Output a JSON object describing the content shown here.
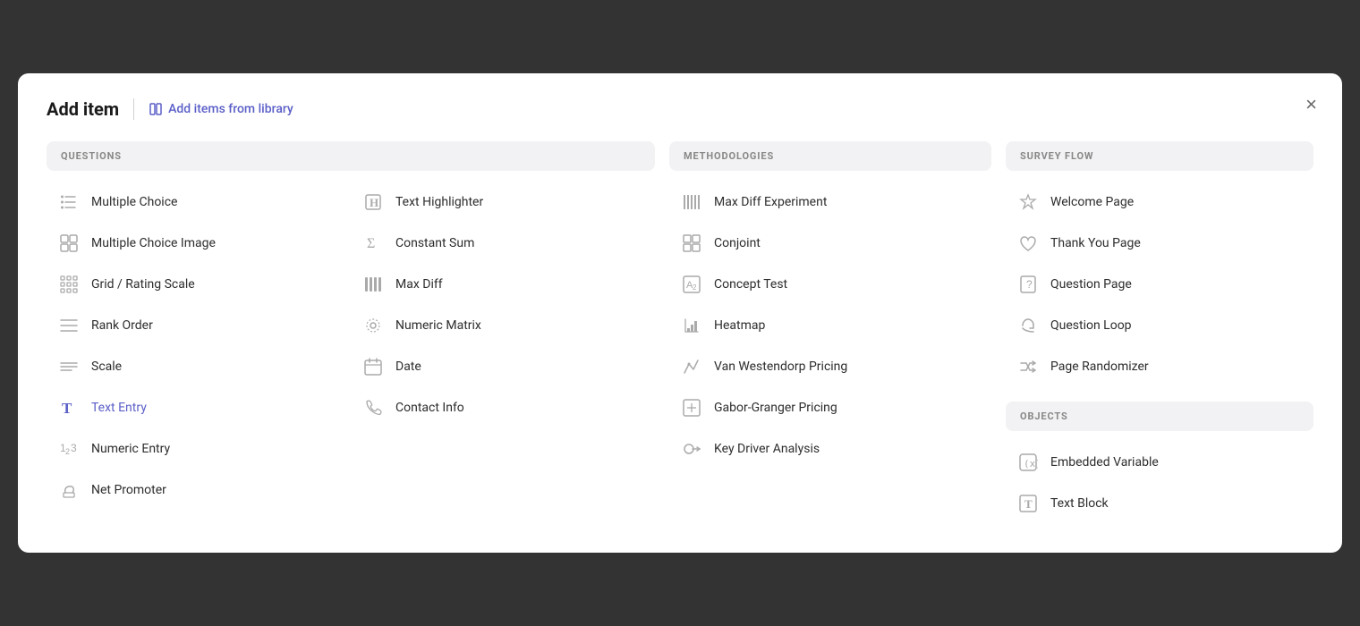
{
  "modal": {
    "title": "Add item",
    "add_library_label": "Add items from library",
    "close_label": "×"
  },
  "sections": {
    "questions": {
      "header": "QUESTIONS",
      "col1": [
        {
          "id": "multiple-choice",
          "label": "Multiple Choice",
          "icon": "≡•",
          "active": false
        },
        {
          "id": "multiple-choice-image",
          "label": "Multiple Choice Image",
          "icon": "⊞",
          "active": false
        },
        {
          "id": "grid-rating-scale",
          "label": "Grid / Rating Scale",
          "icon": "⊟⊟",
          "active": false
        },
        {
          "id": "rank-order",
          "label": "Rank Order",
          "icon": "≡•",
          "active": false
        },
        {
          "id": "scale",
          "label": "Scale",
          "icon": "⊟—",
          "active": false
        },
        {
          "id": "text-entry",
          "label": "Text Entry",
          "icon": "T",
          "active": true
        },
        {
          "id": "numeric-entry",
          "label": "Numeric Entry",
          "icon": "1₂₃",
          "active": false
        },
        {
          "id": "net-promoter",
          "label": "Net Promoter",
          "icon": "👍",
          "active": false
        }
      ],
      "col2": [
        {
          "id": "text-highlighter",
          "label": "Text Highlighter",
          "icon": "H",
          "active": false
        },
        {
          "id": "constant-sum",
          "label": "Constant Sum",
          "icon": "Σ",
          "active": false
        },
        {
          "id": "max-diff",
          "label": "Max Diff",
          "icon": "⋮⋮⋮",
          "active": false
        },
        {
          "id": "numeric-matrix",
          "label": "Numeric Matrix",
          "icon": "⊕",
          "active": false
        },
        {
          "id": "date",
          "label": "Date",
          "icon": "📅",
          "active": false
        },
        {
          "id": "contact-info",
          "label": "Contact Info",
          "icon": "📞",
          "active": false
        }
      ]
    },
    "methodologies": {
      "header": "METHODOLOGIES",
      "items": [
        {
          "id": "max-diff-experiment",
          "label": "Max Diff Experiment",
          "icon": "⋮⋮⋮",
          "active": false
        },
        {
          "id": "conjoint",
          "label": "Conjoint",
          "icon": "⊞⊞",
          "active": false
        },
        {
          "id": "concept-test",
          "label": "Concept Test",
          "icon": "A₂",
          "active": false
        },
        {
          "id": "heatmap",
          "label": "Heatmap",
          "icon": "🌡",
          "active": false
        },
        {
          "id": "van-westendorp",
          "label": "Van Westendorp Pricing",
          "icon": "🏷",
          "active": false
        },
        {
          "id": "gabor-granger",
          "label": "Gabor-Granger Pricing",
          "icon": "⊡",
          "active": false
        },
        {
          "id": "key-driver-analysis",
          "label": "Key Driver Analysis",
          "icon": "🔑",
          "active": false
        }
      ]
    },
    "survey_flow": {
      "header": "SURVEY FLOW",
      "items": [
        {
          "id": "welcome-page",
          "label": "Welcome Page",
          "icon": "✋",
          "active": false
        },
        {
          "id": "thank-you-page",
          "label": "Thank You Page",
          "icon": "♡",
          "active": false
        },
        {
          "id": "question-page",
          "label": "Question Page",
          "icon": "?□",
          "active": false
        },
        {
          "id": "question-loop",
          "label": "Question Loop",
          "icon": "↺",
          "active": false
        },
        {
          "id": "page-randomizer",
          "label": "Page Randomizer",
          "icon": "⇄",
          "active": false
        }
      ]
    },
    "objects": {
      "header": "OBJECTS",
      "items": [
        {
          "id": "embedded-variable",
          "label": "Embedded Variable",
          "icon": "(x)",
          "active": false
        },
        {
          "id": "text-block",
          "label": "Text Block",
          "icon": "T□",
          "active": false
        }
      ]
    }
  }
}
